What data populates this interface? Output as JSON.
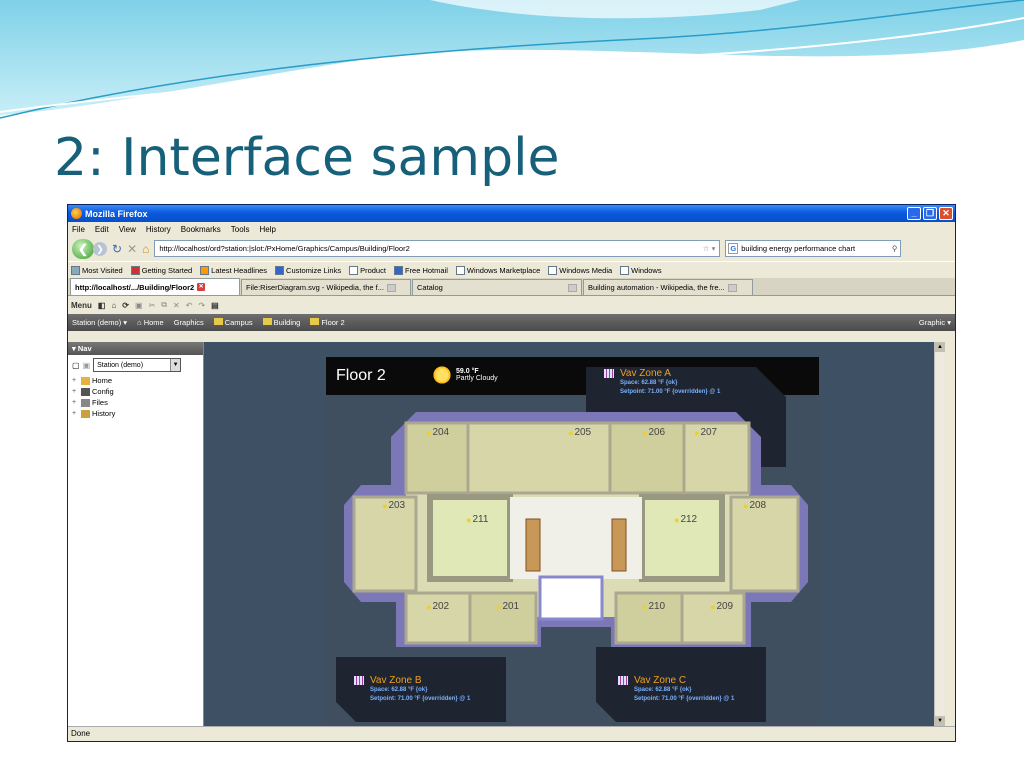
{
  "slide": {
    "title": "2: Interface sample"
  },
  "window": {
    "title": "Mozilla Firefox",
    "status": "Done"
  },
  "menu": [
    "File",
    "Edit",
    "View",
    "History",
    "Bookmarks",
    "Tools",
    "Help"
  ],
  "nav": {
    "url": "http://localhost/ord?station:|slot:/PxHome/Graphics/Campus/Building/Floor2",
    "search": "building energy performance chart"
  },
  "bookmarks": [
    "Most Visited",
    "Getting Started",
    "Latest Headlines",
    "Customize Links",
    "Product",
    "Free Hotmail",
    "Windows Marketplace",
    "Windows Media",
    "Windows"
  ],
  "tabs": [
    "http://localhost/.../Building/Floor2",
    "File:RiserDiagram.svg - Wikipedia, the f...",
    "Catalog",
    "Building automation - Wikipedia, the fre..."
  ],
  "toolbar": {
    "menu": "Menu"
  },
  "breadcrumb": [
    "Station (demo)",
    "Home",
    "Graphics",
    "Campus",
    "Building",
    "Floor 2"
  ],
  "graphic_btn": "Graphic",
  "sidebar": {
    "title": "Nav",
    "station": "Station (demo)",
    "tree": [
      "Home",
      "Config",
      "Files",
      "History"
    ]
  },
  "floor": {
    "title": "Floor 2",
    "weather": {
      "temp": "59.0 °F",
      "cond": "Partly Cloudy"
    }
  },
  "zones": [
    {
      "name": "Vav Zone A",
      "space": "Space: 62.88 °F {ok}",
      "setpoint": "Setpoint: 71.00 °F {overridden} @ 1"
    },
    {
      "name": "Vav Zone B",
      "space": "Space: 62.88 °F {ok}",
      "setpoint": "Setpoint: 71.00 °F {overridden} @ 1"
    },
    {
      "name": "Vav Zone C",
      "space": "Space: 62.88 °F {ok}",
      "setpoint": "Setpoint: 71.00 °F {overridden} @ 1"
    }
  ],
  "rooms": [
    "204",
    "205",
    "206",
    "207",
    "203",
    "211",
    "212",
    "208",
    "202",
    "201",
    "210",
    "209"
  ]
}
